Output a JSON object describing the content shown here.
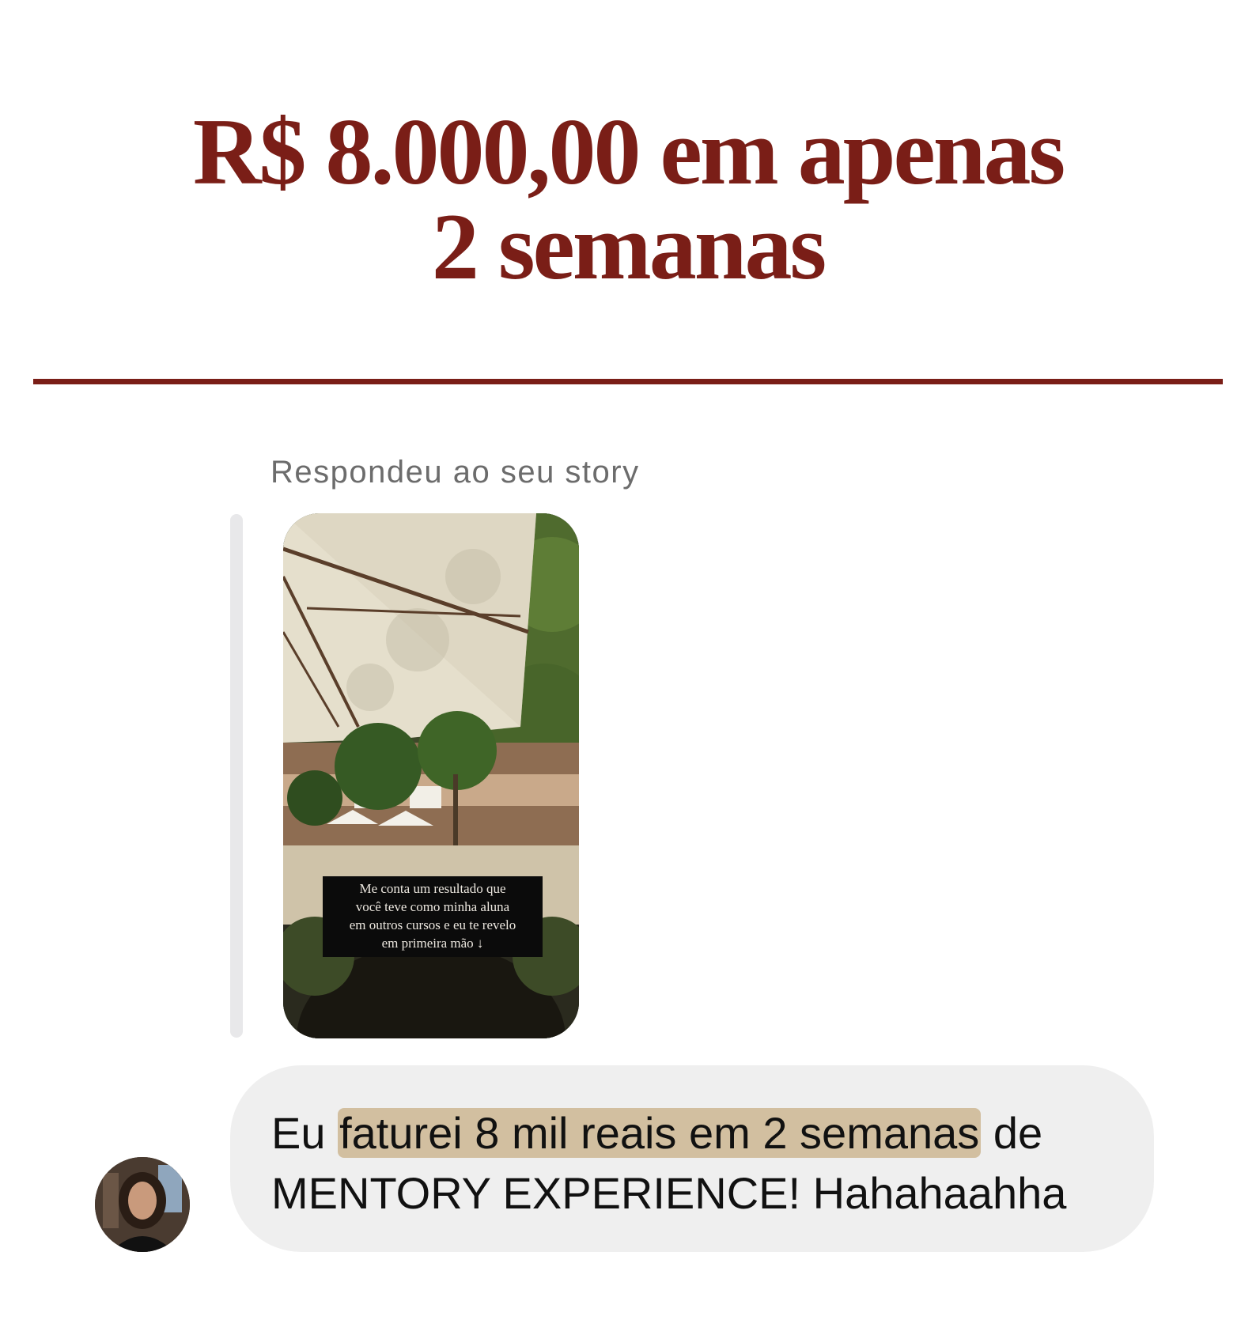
{
  "headline": {
    "line1": "R$ 8.000,00 em apenas",
    "line2": "2 semanas"
  },
  "colors": {
    "accent": "#7a1e17",
    "bubble": "#efefef",
    "highlight": "#d2bfa0"
  },
  "conversation": {
    "reply_label": "Respondeu ao seu story",
    "story": {
      "caption_line1": "Me conta um resultado que",
      "caption_line2": "você teve como minha aluna",
      "caption_line3": "em outros cursos e eu te revelo",
      "caption_line4": "em primeira mão ↓"
    },
    "message": {
      "before_highlight": "Eu ",
      "highlight": "faturei 8 mil reais em 2 semanas",
      "after_highlight": " de MENTORY EXPERIENCE! Hahahaahha"
    },
    "avatar_icon": "user-avatar-photo"
  }
}
